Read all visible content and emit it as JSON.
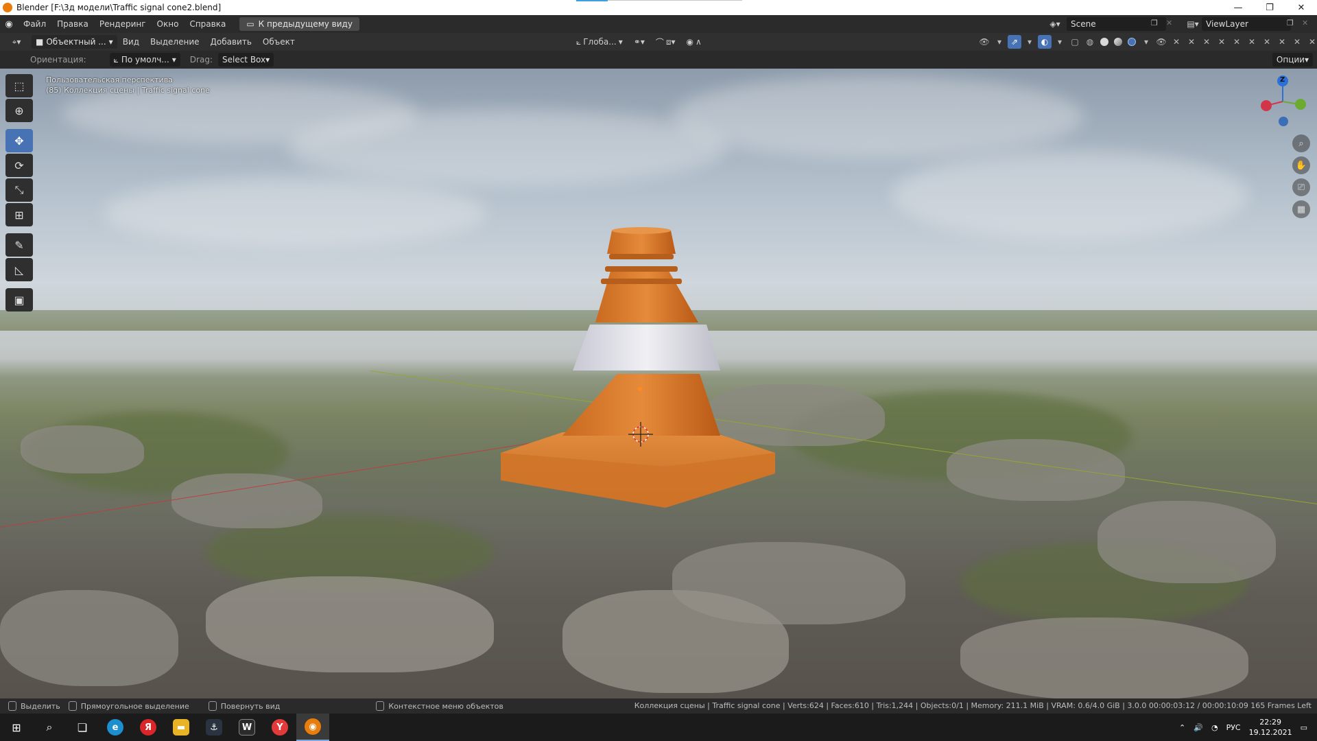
{
  "window": {
    "title": "Blender [F:\\3д модели\\Traffic signal cone2.blend]",
    "minimize": "—",
    "maximize": "❐",
    "close": "✕"
  },
  "topbar": {
    "menus": [
      "Файл",
      "Правка",
      "Рендеринг",
      "Окно",
      "Справка"
    ],
    "back_button": "К предыдущему виду",
    "scene": "Scene",
    "view_layer": "ViewLayer"
  },
  "header": {
    "mode": "Объектный ...",
    "menus": [
      "Вид",
      "Выделение",
      "Добавить",
      "Объект"
    ],
    "orientation": "Глоба...",
    "pivot_icon": "pivot-icon",
    "snap_icon": "snap-icon",
    "proportional_icon": "proportional-icon"
  },
  "tool_options": {
    "orientation_label": "Ориентация:",
    "orientation_value": "По умолч...",
    "drag_label": "Drag:",
    "drag_value": "Select Box",
    "options_button": "Опции"
  },
  "viewport": {
    "view_name": "Пользовательская перспектива",
    "collection_info": "(85) Коллекция сцены | Traffic signal cone",
    "gizmo": {
      "x_color": "#d2354a",
      "y_color": "#6bab2f",
      "z_color": "#2c6fd6",
      "z_label": "Z"
    }
  },
  "tools": [
    {
      "name": "select-box-tool",
      "icon": "⬚",
      "active": false
    },
    {
      "name": "cursor-tool",
      "icon": "⊕",
      "active": false
    },
    {
      "name": "move-tool",
      "icon": "✥",
      "active": true
    },
    {
      "name": "rotate-tool",
      "icon": "⟳",
      "active": false
    },
    {
      "name": "scale-tool",
      "icon": "⤡",
      "active": false
    },
    {
      "name": "transform-tool",
      "icon": "⊞",
      "active": false
    },
    {
      "name": "annotate-tool",
      "icon": "✎",
      "active": false
    },
    {
      "name": "measure-tool",
      "icon": "📐",
      "active": false
    },
    {
      "name": "add-cube-tool",
      "icon": "▣",
      "active": false
    }
  ],
  "statusbar": {
    "select": "Выделить",
    "box_select": "Прямоугольное выделение",
    "rotate_view": "Повернуть вид",
    "context_menu": "Контекстное меню объектов",
    "stats": "Коллекция сцены | Traffic signal cone | Verts:624 | Faces:610 | Tris:1,244 | Objects:0/1 | Memory: 211.1 MiB | VRAM: 0.6/4.0 GiB | 3.0.0  00:00:03:12 / 00:00:10:09  165 Frames Left"
  },
  "taskbar": {
    "language": "РУС",
    "time": "22:29",
    "date": "19.12.2021",
    "apps": [
      {
        "name": "edge-app",
        "glyph": "e",
        "color": "#1d8fce"
      },
      {
        "name": "yandex-app",
        "glyph": "Я",
        "color": "#d9262a"
      },
      {
        "name": "explorer-app",
        "glyph": "▬",
        "color": "#e8b325"
      },
      {
        "name": "warships-app",
        "glyph": "⚓",
        "color": "#2a3440"
      },
      {
        "name": "tanks-app",
        "glyph": "W",
        "color": "#2b2b2b"
      },
      {
        "name": "yandex-browser-app",
        "glyph": "Y",
        "color": "#e23a3a"
      },
      {
        "name": "blender-app",
        "glyph": "◉",
        "color": "#e87d0d"
      }
    ]
  }
}
